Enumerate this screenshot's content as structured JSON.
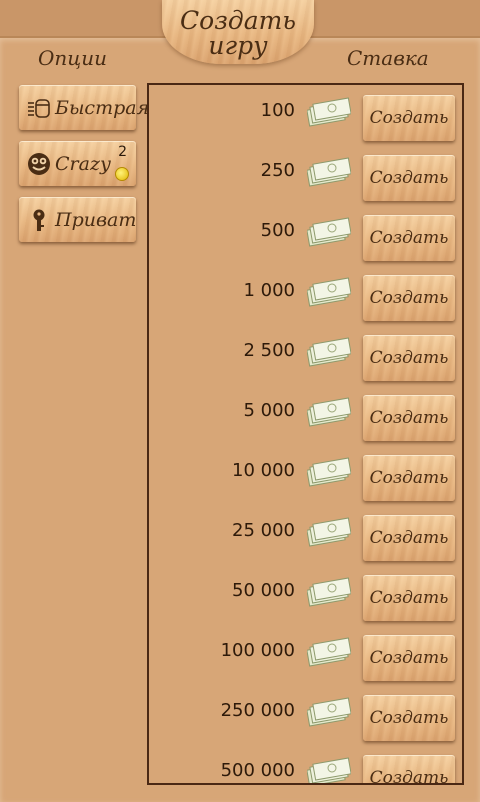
{
  "header": {
    "title_line1": "Создать",
    "title_line2": "игру"
  },
  "options": {
    "header": "Опции",
    "items": [
      {
        "label": "Быстрая",
        "icon": "quick-game-icon"
      },
      {
        "label": "Crazy",
        "badge": "2",
        "icon": "crazy-face-icon"
      },
      {
        "label": "Приват",
        "icon": "key-icon"
      }
    ]
  },
  "stakes": {
    "header": "Ставка",
    "button_label": "Создать",
    "rows": [
      {
        "amount": "100"
      },
      {
        "amount": "250"
      },
      {
        "amount": "500"
      },
      {
        "amount": "1 000"
      },
      {
        "amount": "2 500"
      },
      {
        "amount": "5 000"
      },
      {
        "amount": "10 000"
      },
      {
        "amount": "25 000"
      },
      {
        "amount": "50 000"
      },
      {
        "amount": "100 000"
      },
      {
        "amount": "250 000"
      },
      {
        "amount": "500 000"
      }
    ]
  },
  "colors": {
    "panel": "#d7a677",
    "text": "#4a2d14",
    "border": "#4a2814",
    "banknote": "#e8ecd2"
  }
}
